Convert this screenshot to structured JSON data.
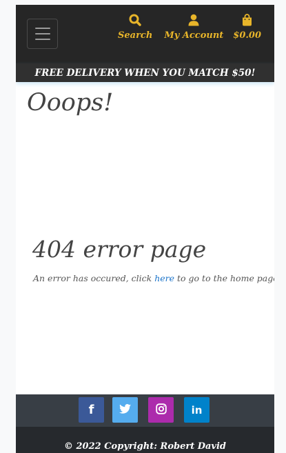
{
  "header": {
    "menu_icon": "hamburger-icon",
    "nav": [
      {
        "icon": "search-icon",
        "label": "Search"
      },
      {
        "icon": "user-icon",
        "label": "My Account"
      },
      {
        "icon": "shopping-bag-icon",
        "label": "$0.00"
      }
    ],
    "accent_color": "#e8b52a"
  },
  "banner": {
    "text": "FREE DELIVERY WHEN YOU MATCH $50!"
  },
  "main": {
    "title": "Ooops!",
    "error_heading": "404 error page",
    "error_text_before": "An error has occured, click ",
    "error_link": "here",
    "error_text_after": " to go to the home page."
  },
  "footer": {
    "social": [
      {
        "icon": "facebook-icon",
        "glyph": "f",
        "color": "#3b5998"
      },
      {
        "icon": "twitter-icon",
        "glyph": "",
        "color": "#55acee"
      },
      {
        "icon": "instagram-icon",
        "glyph": "",
        "color": "#ac2bac"
      },
      {
        "icon": "linkedin-icon",
        "glyph": "in",
        "color": "#0082ca"
      }
    ],
    "copyright": "© 2022 Copyright: Robert David"
  }
}
